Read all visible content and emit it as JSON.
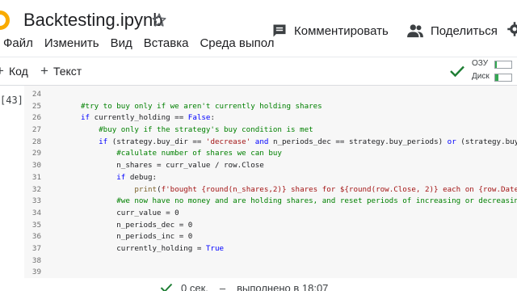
{
  "header": {
    "title": "Backtesting.ipynb",
    "menu": [
      "Файл",
      "Изменить",
      "Вид",
      "Вставка",
      "Среда выпол"
    ],
    "comment_label": "Комментировать",
    "share_label": "Поделиться"
  },
  "toolbar": {
    "add_code": "Код",
    "add_text": "Текст",
    "ram_label": "ОЗУ",
    "disk_label": "Диск",
    "ram_usage": 0.12,
    "disk_usage": 0.2
  },
  "cell": {
    "execution_count": "[43]",
    "lines": [
      {
        "n": "24",
        "code": ""
      },
      {
        "n": "25",
        "code": "#try to buy only if we aren't currently holding shares"
      },
      {
        "n": "26",
        "code": "if currently_holding == False:"
      },
      {
        "n": "27",
        "code": "    #buy only if the strategy's buy condition is met"
      },
      {
        "n": "28",
        "code": "    if (strategy.buy_dir == 'decrease' and n_periods_dec == strategy.buy_periods) or (strategy.buy_d"
      },
      {
        "n": "29",
        "code": "        #calulate number of shares we can buy"
      },
      {
        "n": "30",
        "code": "        n_shares = curr_value / row.Close"
      },
      {
        "n": "31",
        "code": "        if debug:"
      },
      {
        "n": "32",
        "code": "            print(f'bought {round(n_shares,2)} shares for ${round(row.Close, 2)} each on {row.Date}')"
      },
      {
        "n": "33",
        "code": "        #we now have no money and are holding shares, and reset periods of increasing or decreasing"
      },
      {
        "n": "34",
        "code": "        curr_value = 0"
      },
      {
        "n": "35",
        "code": "        n_periods_dec = 0"
      },
      {
        "n": "36",
        "code": "        n_periods_inc = 0"
      },
      {
        "n": "37",
        "code": "        currently_holding = True"
      },
      {
        "n": "38",
        "code": ""
      },
      {
        "n": "39",
        "code": ""
      }
    ]
  },
  "status": {
    "duration": "0 сек.",
    "completed": "выполнено в 18:07"
  }
}
